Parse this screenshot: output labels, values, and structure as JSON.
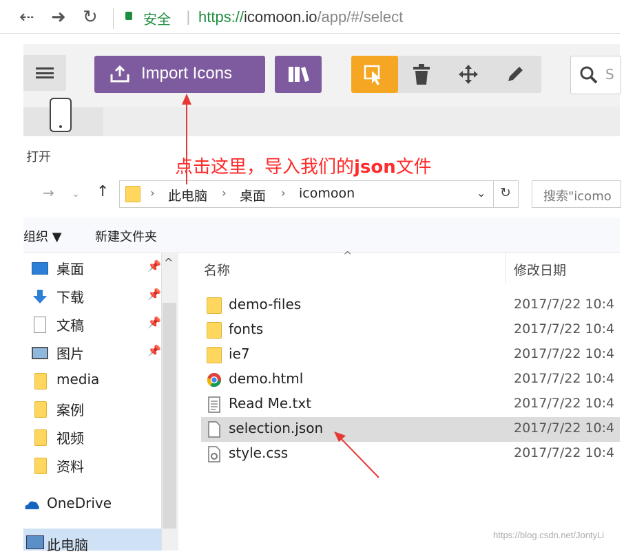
{
  "browser": {
    "secure_label": "安全",
    "url_scheme": "https://",
    "url_host": "icomoon.io",
    "url_path": "/app/#/select"
  },
  "toolbar": {
    "import_label": "Import Icons",
    "search_placeholder": "S"
  },
  "dialog": {
    "title": "打开",
    "annotation_prefix": "点击这里，导入我们的",
    "annotation_bold": "json",
    "annotation_suffix": "文件",
    "breadcrumb": [
      "此电脑",
      "桌面",
      "icomoon"
    ],
    "search_placeholder": "搜索\"icomo",
    "organize_label": "组织 ▼",
    "new_folder_label": "新建文件夹",
    "sidebar": [
      {
        "label": "桌面",
        "icon": "desktop-icon",
        "pinned": true
      },
      {
        "label": "下载",
        "icon": "download-icon",
        "pinned": true
      },
      {
        "label": "文稿",
        "icon": "document-icon",
        "pinned": true
      },
      {
        "label": "图片",
        "icon": "picture-icon",
        "pinned": true
      },
      {
        "label": "media",
        "icon": "folder-icon",
        "pinned": false
      },
      {
        "label": "案例",
        "icon": "folder-icon",
        "pinned": false
      },
      {
        "label": "视频",
        "icon": "folder-icon",
        "pinned": false
      },
      {
        "label": "资料",
        "icon": "folder-icon",
        "pinned": false
      },
      {
        "label": "OneDrive",
        "icon": "cloud-icon",
        "pinned": false
      },
      {
        "label": "此电脑",
        "icon": "computer-icon",
        "pinned": false
      }
    ],
    "columns": {
      "name": "名称",
      "modified": "修改日期"
    },
    "files": [
      {
        "name": "demo-files",
        "date": "2017/7/22 10:4",
        "icon": "folder-icon"
      },
      {
        "name": "fonts",
        "date": "2017/7/22 10:4",
        "icon": "folder-icon"
      },
      {
        "name": "ie7",
        "date": "2017/7/22 10:4",
        "icon": "folder-icon"
      },
      {
        "name": "demo.html",
        "date": "2017/7/22 10:4",
        "icon": "chrome-icon"
      },
      {
        "name": "Read Me.txt",
        "date": "2017/7/22 10:4",
        "icon": "text-file-icon"
      },
      {
        "name": "selection.json",
        "date": "2017/7/22 10:4",
        "icon": "file-icon"
      },
      {
        "name": "style.css",
        "date": "2017/7/22 10:4",
        "icon": "css-file-icon"
      }
    ]
  },
  "watermark": "https://blog.csdn.net/JontyLi",
  "colors": {
    "accent_purple": "#7e5a9e",
    "select_orange": "#f5a623",
    "annotation_red": "#ff2a2a"
  }
}
